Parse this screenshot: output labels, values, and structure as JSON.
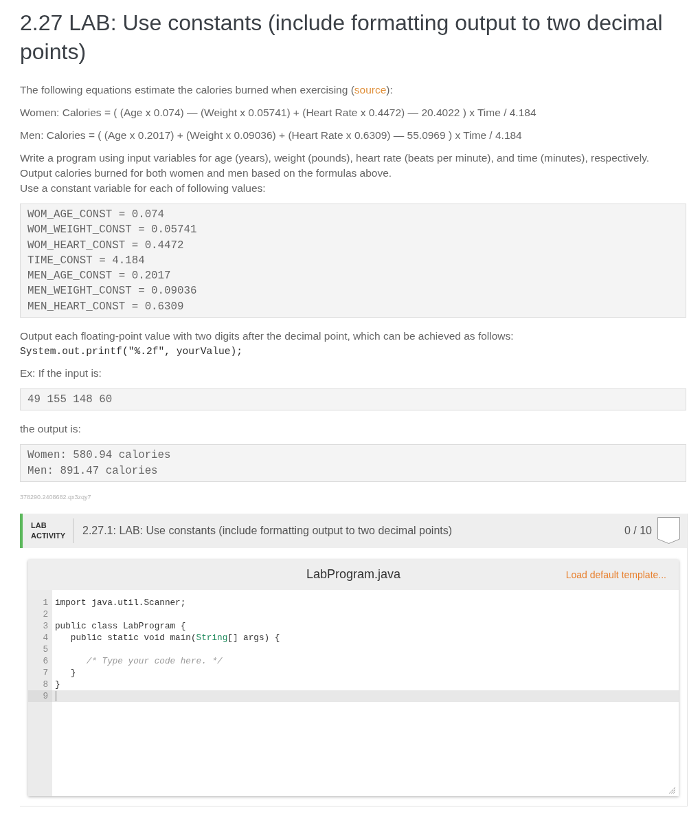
{
  "title": "2.27 LAB: Use constants (include formatting output to two decimal points)",
  "intro": {
    "before": "The following equations estimate the calories burned when exercising (",
    "link": "source",
    "after": "):"
  },
  "formulas": [
    "Women: Calories = ( (Age x 0.074) — (Weight x 0.05741) + (Heart Rate x 0.4472) — 20.4022 ) x Time / 4.184",
    "Men: Calories = ( (Age x 0.2017) + (Weight x 0.09036) + (Heart Rate x 0.6309) — 55.0969 ) x Time / 4.184"
  ],
  "instructions": [
    "Write a program using input variables for age (years), weight (pounds), heart rate (beats per minute), and time (minutes), respectively.",
    "Output calories burned for both women and men based on the formulas above.",
    "Use a constant variable for each of following values:"
  ],
  "constants_block": [
    "WOM_AGE_CONST = 0.074",
    "WOM_WEIGHT_CONST = 0.05741",
    "WOM_HEART_CONST = 0.4472",
    "TIME_CONST = 4.184",
    "MEN_AGE_CONST = 0.2017",
    "MEN_WEIGHT_CONST = 0.09036",
    "MEN_HEART_CONST = 0.6309"
  ],
  "format_note": "Output each floating-point value with two digits after the decimal point, which can be achieved as follows:",
  "format_code": "System.out.printf(\"%.2f\", yourValue);",
  "input_label": "Ex: If the input is:",
  "sample_input": [
    "49 155 148 60"
  ],
  "output_label": "the output is:",
  "sample_output": [
    "Women: 580.94 calories",
    "Men: 891.47 calories"
  ],
  "content_id": "378290.2408682.qx3zqy7",
  "lab_activity": {
    "label": "LAB ACTIVITY",
    "title": "2.27.1: LAB: Use constants (include formatting output to two decimal points)",
    "score": "0 / 10",
    "completed": false,
    "editor": {
      "filename": "LabProgram.java",
      "load_template": "Load default template...",
      "lines": [
        {
          "number": "1",
          "active": false,
          "segments": [
            {
              "kind": "plain",
              "text": "import java.util.Scanner;"
            }
          ]
        },
        {
          "number": "2",
          "active": false
        },
        {
          "number": "3",
          "active": false,
          "segments": [
            {
              "kind": "plain",
              "text": "public class LabProgram {"
            }
          ]
        },
        {
          "number": "4",
          "active": false,
          "segments": [
            {
              "kind": "plain",
              "text": "   public static void main("
            },
            {
              "kind": "type",
              "text": "String"
            },
            {
              "kind": "plain",
              "text": "[] args) {"
            }
          ]
        },
        {
          "number": "5",
          "active": false
        },
        {
          "number": "6",
          "active": false,
          "segments": [
            {
              "kind": "comment",
              "text": "      /* Type your code here. */"
            }
          ]
        },
        {
          "number": "7",
          "active": false,
          "segments": [
            {
              "kind": "plain",
              "text": "   }"
            }
          ]
        },
        {
          "number": "8",
          "active": false,
          "segments": [
            {
              "kind": "plain",
              "text": "}"
            }
          ]
        },
        {
          "number": "9",
          "active": true
        }
      ]
    }
  }
}
